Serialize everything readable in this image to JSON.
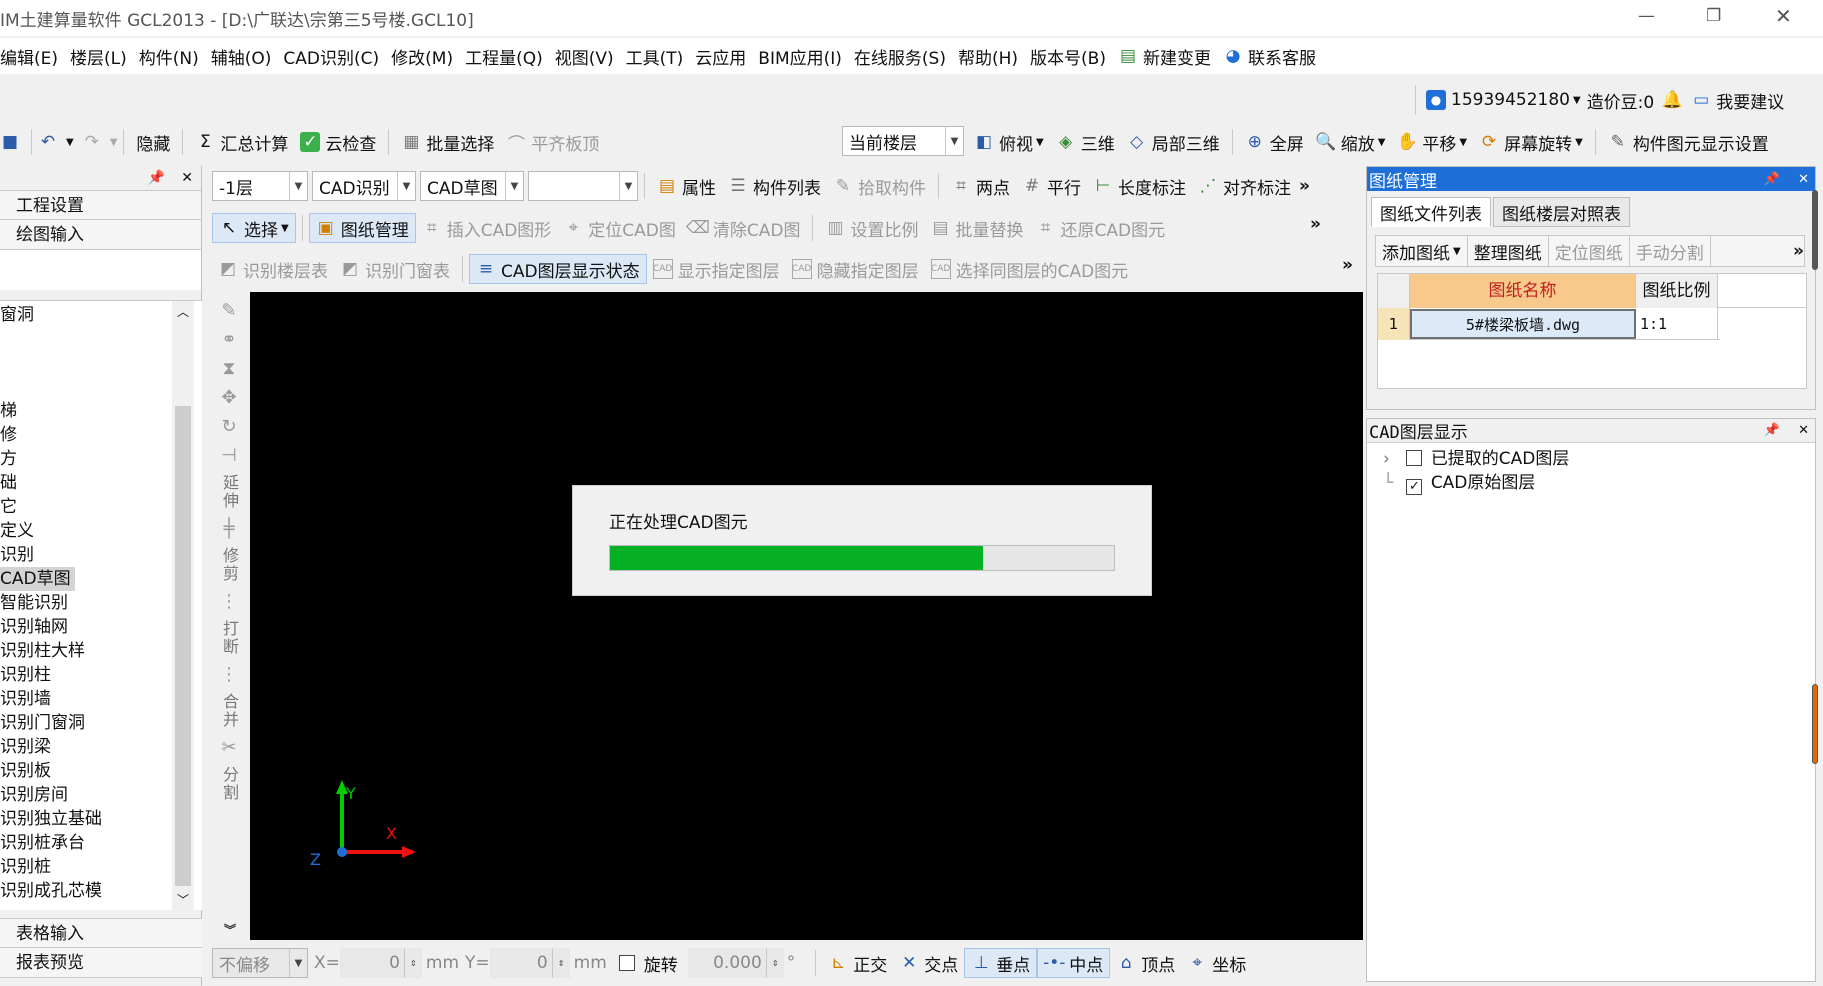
{
  "window": {
    "title": "IM土建算量软件 GCL2013 - [D:\\广联达\\宗第三5号楼.GCL10]",
    "controls": [
      "—",
      "❐",
      "✕"
    ]
  },
  "menu": {
    "items": [
      "编辑(E)",
      "楼层(L)",
      "构件(N)",
      "辅轴(O)",
      "CAD识别(C)",
      "修改(M)",
      "工程量(Q)",
      "视图(V)",
      "工具(T)",
      "云应用",
      "BIM应用(I)",
      "在线服务(S)",
      "帮助(H)",
      "版本号(B)"
    ],
    "new_change": "新建变更",
    "support": "联系客服"
  },
  "account": {
    "phone": "15939452180",
    "beans": "造价豆:0",
    "suggest": "我要建议"
  },
  "toolbar1": {
    "hide": "隐藏",
    "sum": "汇总计算",
    "cloud_check": "云检查",
    "batch_select": "批量选择",
    "align_top": "平齐板顶",
    "floor_select": "当前楼层",
    "view_top": "俯视",
    "view_3d": "三维",
    "local_3d": "局部三维",
    "fullscreen": "全屏",
    "zoom": "缩放",
    "pan": "平移",
    "rotate": "屏幕旋转",
    "display_settings": "构件图元显示设置"
  },
  "toolbar2": {
    "floor": "-1层",
    "mode": "CAD识别",
    "sub_mode": "CAD草图",
    "blank": "",
    "props": "属性",
    "component_list": "构件列表",
    "pick_component": "拾取构件",
    "two_point": "两点",
    "parallel": "平行",
    "length_dim": "长度标注",
    "align_dim": "对齐标注"
  },
  "toolbar3": {
    "select": "选择",
    "drawing_mgmt": "图纸管理",
    "insert_cad": "插入CAD图形",
    "locate_cad": "定位CAD图",
    "clear_cad": "清除CAD图",
    "set_scale": "设置比例",
    "batch_replace": "批量替换",
    "restore_cad": "还原CAD图元"
  },
  "toolbar4": {
    "id_floor_table": "识别楼层表",
    "id_door_table": "识别门窗表",
    "layer_state": "CAD图层显示状态",
    "show_layer": "显示指定图层",
    "hide_layer": "隐藏指定图层",
    "select_same_layer": "选择同图层的CAD图元"
  },
  "left_panel": {
    "items_top": [
      "工程设置",
      "绘图输入"
    ],
    "tree": [
      "窗洞",
      "",
      "",
      "",
      "梯",
      "修",
      "方",
      "础",
      "它",
      "定义",
      "识别",
      "CAD草图",
      "智能识别",
      "识别轴网",
      "识别柱大样",
      "识别柱",
      "识别墙",
      "识别门窗洞",
      "识别梁",
      "识别板",
      "识别房间",
      "识别独立基础",
      "识别桩承台",
      "识别桩",
      "识别成孔芯模"
    ],
    "items_bottom": [
      "表格输入",
      "报表预览"
    ]
  },
  "vertical_tools": [
    "延伸",
    "修剪",
    "打断",
    "合并",
    "分割"
  ],
  "progress": {
    "label": "正在处理CAD图元",
    "fraction": 0.74
  },
  "axis": {
    "x": "X",
    "y": "Y",
    "z": "Z"
  },
  "statusbar": {
    "no_offset": "不偏移",
    "x_label": "X=",
    "x_val": "0",
    "unit": "mm",
    "y_label": "Y=",
    "y_val": "0",
    "rotate": "旋转",
    "angle": "0.000",
    "degree": "°",
    "snaps": [
      "正交",
      "交点",
      "垂点",
      "中点",
      "顶点",
      "坐标"
    ]
  },
  "drawing_panel": {
    "title": "图纸管理",
    "tabs": [
      "图纸文件列表",
      "图纸楼层对照表"
    ],
    "buttons": [
      "添加图纸",
      "整理图纸",
      "定位图纸",
      "手动分割"
    ],
    "columns": [
      "图纸名称",
      "图纸比例"
    ],
    "rows": [
      {
        "idx": "1",
        "name": "5#楼梁板墙.dwg",
        "scale": "1:1"
      }
    ]
  },
  "layer_panel": {
    "title": "CAD图层显示",
    "items": [
      "已提取的CAD图层",
      "CAD原始图层"
    ]
  },
  "colors": {
    "accent": "#1e6fd8",
    "progress": "#06b025",
    "canvas": "#000000"
  }
}
